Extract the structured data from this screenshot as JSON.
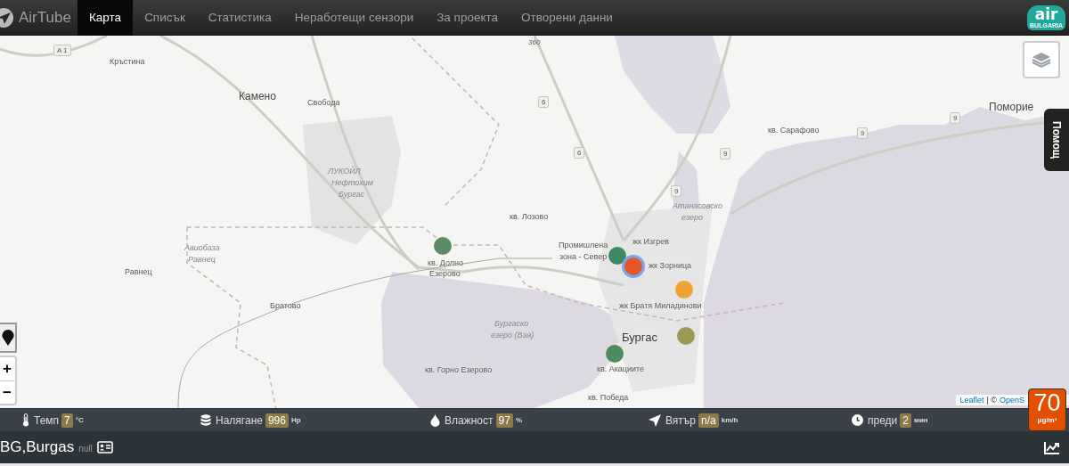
{
  "brand": {
    "name": "AirTube"
  },
  "nav": [
    {
      "label": "Карта",
      "selected": true
    },
    {
      "label": "Списък",
      "selected": false
    },
    {
      "label": "Статистика",
      "selected": false
    },
    {
      "label": "Неработещи сензори",
      "selected": false
    },
    {
      "label": "За проекта",
      "selected": false
    },
    {
      "label": "Отворени данни",
      "selected": false
    }
  ],
  "partner_logo": {
    "text": "air",
    "subtitle": "BULGARIA"
  },
  "map": {
    "labels": [
      {
        "text": "Кръстина",
        "kind": "village"
      },
      {
        "text": "Камено",
        "kind": "town"
      },
      {
        "text": "Свобода",
        "kind": "village"
      },
      {
        "text": "ЛУКОЙЛ",
        "kind": "area"
      },
      {
        "text": "Нефтохим",
        "kind": "area"
      },
      {
        "text": "Бургас",
        "kind": "area"
      },
      {
        "text": "Авиобаза",
        "kind": "area"
      },
      {
        "text": "Равнец",
        "kind": "area"
      },
      {
        "text": "Равнец",
        "kind": "village"
      },
      {
        "text": "Братово",
        "kind": "village"
      },
      {
        "text": "кв. Лозово",
        "kind": "village"
      },
      {
        "text": "кв. Долно",
        "kind": "village"
      },
      {
        "text": "Езерово",
        "kind": "village"
      },
      {
        "text": "Бургаско",
        "kind": "area"
      },
      {
        "text": "езеро (Вая)",
        "kind": "area"
      },
      {
        "text": "кв. Горно Езерово",
        "kind": "village"
      },
      {
        "text": "Промишлена",
        "kind": "village"
      },
      {
        "text": "зона - Север",
        "kind": "village"
      },
      {
        "text": "жк Изгрев",
        "kind": "village"
      },
      {
        "text": "жк Зорница",
        "kind": "village"
      },
      {
        "text": "Атанасовско",
        "kind": "area"
      },
      {
        "text": "езеро",
        "kind": "area"
      },
      {
        "text": "жк Братя Миладинови",
        "kind": "village"
      },
      {
        "text": "Бургас",
        "kind": "city"
      },
      {
        "text": "кв. Акациите",
        "kind": "village"
      },
      {
        "text": "кв. Победа",
        "kind": "village"
      },
      {
        "text": "кв. Сарафово",
        "kind": "village"
      },
      {
        "text": "Поморие",
        "kind": "town"
      }
    ],
    "road_shields": [
      "A 1",
      "360",
      "6",
      "6",
      "9",
      "9",
      "9",
      "9"
    ],
    "sensors": [
      {
        "color": "#5b8c66",
        "selected": false
      },
      {
        "color": "#3e8a60",
        "selected": false
      },
      {
        "color": "#e3572a",
        "selected": true
      },
      {
        "color": "#f0a237",
        "selected": false
      },
      {
        "color": "#9b9a52",
        "selected": false
      },
      {
        "color": "#4e8a5c",
        "selected": false
      }
    ],
    "zoom_in": "+",
    "zoom_out": "−",
    "help_tab": "Помощ",
    "attribution": {
      "link": "Leaflet",
      "text": "| ©",
      "source": "OpenS"
    }
  },
  "pm_badge": {
    "value": "70",
    "unit": "μg/m³"
  },
  "readings": [
    {
      "kind": "temperature",
      "label": "Темп",
      "value": "7",
      "unit": "°C"
    },
    {
      "kind": "pressure",
      "label": "Налягане",
      "value": "996",
      "unit": "Hp"
    },
    {
      "kind": "humidity",
      "label": "Влажност",
      "value": "97",
      "unit": "%"
    },
    {
      "kind": "wind",
      "label": "Вятър",
      "value": "n/a",
      "unit": "km/h"
    },
    {
      "kind": "time",
      "label": "преди",
      "value": "2",
      "unit": "мин"
    }
  ],
  "station": {
    "name": "BG,Burgas",
    "note": "null"
  }
}
